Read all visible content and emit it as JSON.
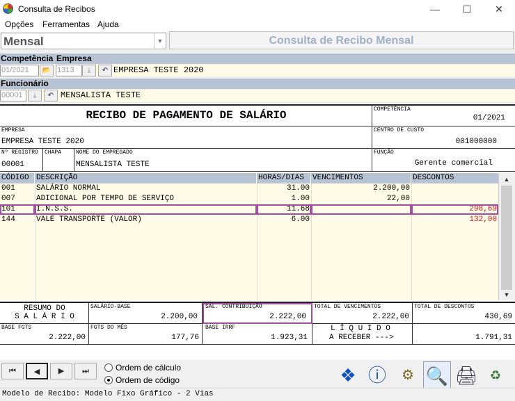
{
  "window": {
    "title": "Consulta de Recibos"
  },
  "menu": [
    "Opções",
    "Ferramentas",
    "Ajuda"
  ],
  "combo": {
    "value": "Mensal"
  },
  "header": {
    "title": "Consulta de Recibo Mensal"
  },
  "filters": {
    "competencia_label": "Competência",
    "empresa_label": "Empresa",
    "competencia_value": "01/2021",
    "empresa_code": "1313",
    "empresa_name": "EMPRESA TESTE 2020",
    "funcionario_label": "Funcionário",
    "funcionario_code": "00001",
    "funcionario_name": "MENSALISTA TESTE"
  },
  "receipt": {
    "title": "RECIBO DE PAGAMENTO DE SALÁRIO",
    "competencia_label": "COMPETÊNCIA",
    "competencia": "01/2021",
    "empresa_label": "EMPRESA",
    "empresa": "EMPRESA TESTE 2020",
    "centro_label": "CENTRO DE CUSTO",
    "centro": "001000000",
    "registro_label": "Nº REGISTRO",
    "registro": "00001",
    "chapa_label": "CHAPA",
    "nome_label": "NOME DO EMPREGADO",
    "nome": "MENSALISTA TESTE",
    "funcao_label": "FUNÇÃO",
    "funcao": "Gerente comercial"
  },
  "grid": {
    "columns": [
      "CÓDIGO",
      "DESCRIÇÃO",
      "HORAS/DIAS",
      "VENCIMENTOS",
      "DESCONTOS"
    ],
    "rows": [
      {
        "code": "001",
        "desc": "SALÁRIO NORMAL",
        "horas": "31.00",
        "venc": "2.200,00",
        "desc_val": ""
      },
      {
        "code": "007",
        "desc": "ADICIONAL POR TEMPO DE SERVIÇO",
        "horas": "1.00",
        "venc": "22,00",
        "desc_val": ""
      },
      {
        "code": "101",
        "desc": "I.N.S.S.",
        "horas": "11.68",
        "venc": "",
        "desc_val": "298,69"
      },
      {
        "code": "144",
        "desc": "VALE TRANSPORTE (VALOR)",
        "horas": "6.00",
        "venc": "",
        "desc_val": "132,00"
      }
    ]
  },
  "totals": {
    "resumo_line1": "RESUMO DO",
    "resumo_line2": "S A L Á R I O",
    "salario_base_label": "SALÁRIO-BASE",
    "salario_base": "2.200,00",
    "sal_contrib_label": "SAL. CONTRIBUIÇÃO",
    "sal_contrib": "2.222,00",
    "total_venc_label": "TOTAL DE VENCIMENTOS",
    "total_venc": "2.222,00",
    "total_desc_label": "TOTAL DE DESCONTOS",
    "total_desc": "430,69",
    "base_fgts_label": "BASE FGTS",
    "base_fgts": "2.222,00",
    "fgts_mes_label": "FGTS DO MÊS",
    "fgts_mes": "177,76",
    "base_irrf_label": "BASE IRRF",
    "base_irrf": "1.923,31",
    "liquido_line1": "L Í Q U I D O",
    "liquido_line2": "A RECEBER --->",
    "liquido": "1.791,31"
  },
  "options": {
    "ordem_calculo": "Ordem de cálculo",
    "ordem_codigo": "Ordem de código"
  },
  "status": {
    "text": "Modelo de Recibo: Modelo Fixo Gráfico - 2 Vias"
  },
  "colors": {
    "accent_highlight": "#a050a0",
    "grid_header": "#b8c4d4",
    "row_yellow": "#fffbe6",
    "discount_red": "#cc2222"
  }
}
